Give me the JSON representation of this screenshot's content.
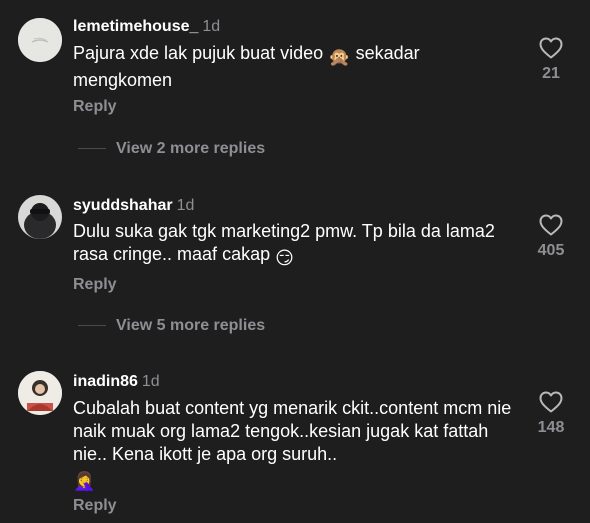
{
  "comments": [
    {
      "username": "lemetimehouse_",
      "time": "1d",
      "text_part1": "Pajura xde lak pujuk buat video",
      "emoji": "🙊",
      "text_part2": "sekadar mengkomen",
      "likes": "21",
      "reply_label": "Reply",
      "view_more": "View 2 more replies"
    },
    {
      "username": "syuddshahar",
      "time": "1d",
      "text_part1": "Dulu suka gak tgk marketing2 pmw. Tp bila da lama2 rasa cringe.. maaf cakap",
      "emoji": "😏",
      "likes": "405",
      "reply_label": "Reply",
      "view_more": "View 5 more replies"
    },
    {
      "username": "inadin86",
      "time": "1d",
      "text_part1": "Cubalah buat content yg menarik ckit..content mcm nie naik muak org lama2 tengok..kesian jugak kat fattah nie.. Kena ikott je apa org suruh..",
      "emoji": "🤦‍♀️",
      "likes": "148",
      "reply_label": "Reply"
    }
  ],
  "icons": {
    "like": "heart-outline-icon"
  },
  "colors": {
    "background": "#1e1e1f",
    "secondary_text": "#8e8e93"
  }
}
